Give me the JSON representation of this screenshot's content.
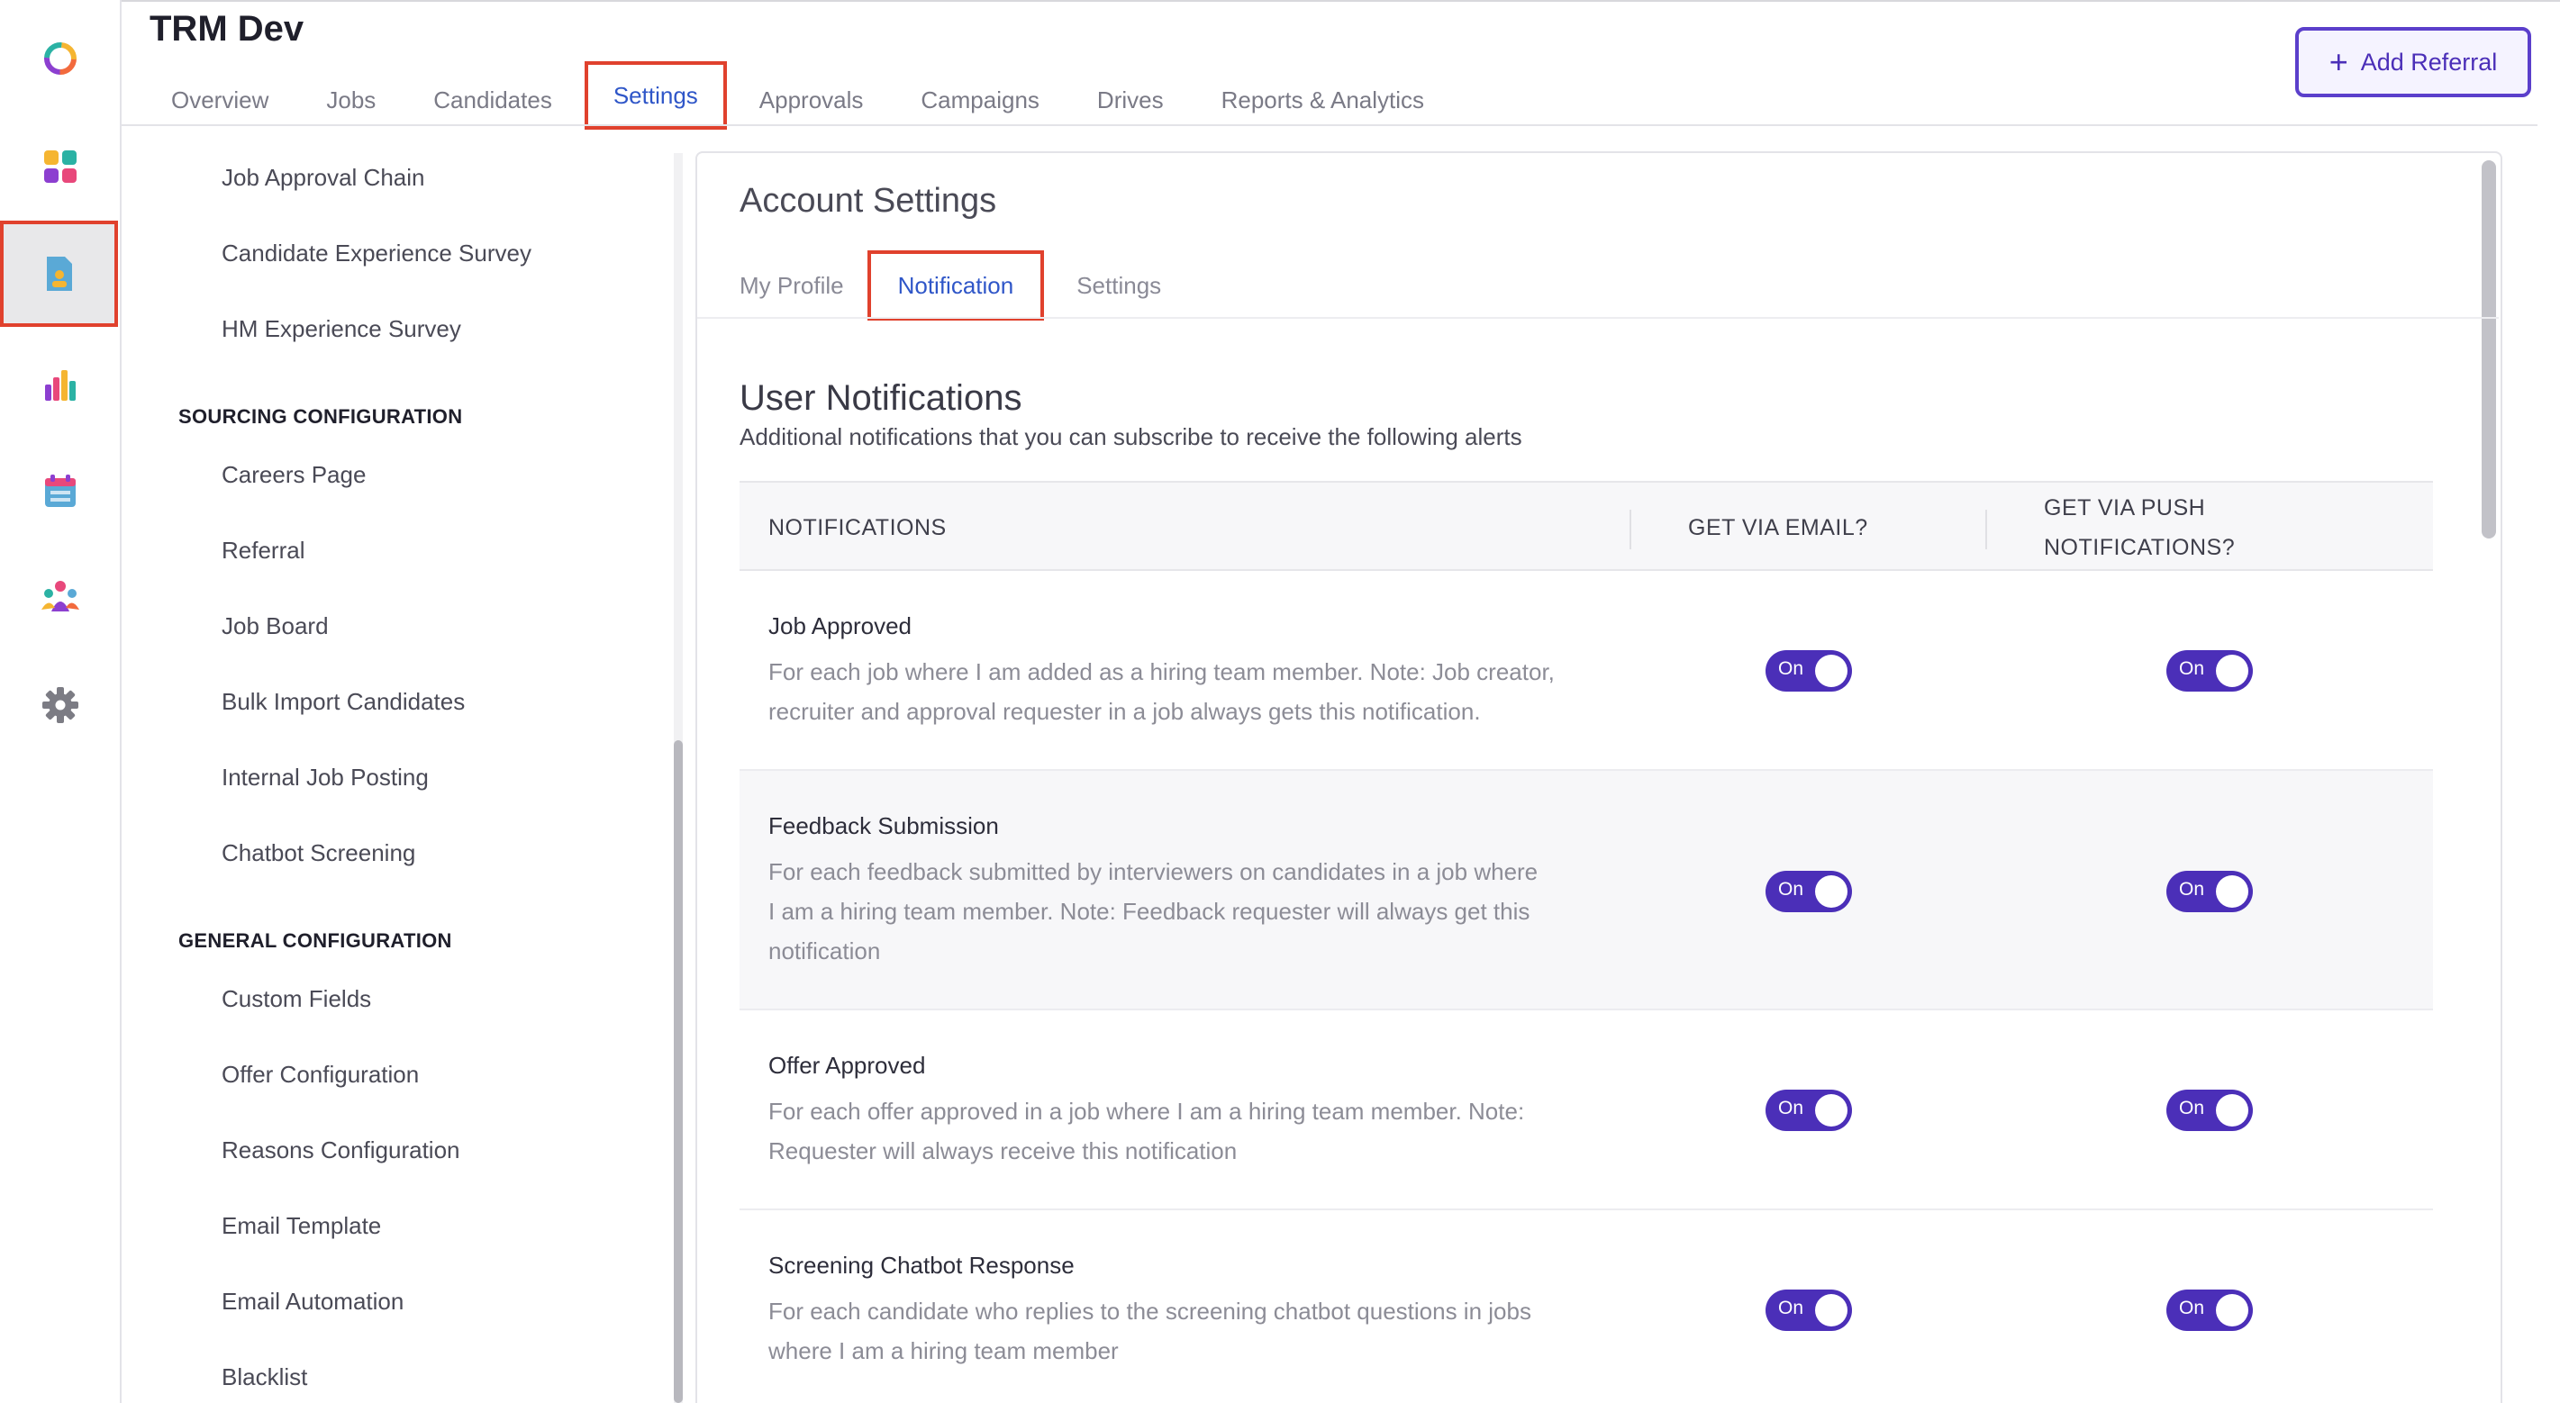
{
  "app": {
    "title": "TRM Dev"
  },
  "rail": {
    "items": [
      "logo-icon",
      "dashboard-icon",
      "document-icon",
      "analytics-icon",
      "calendar-icon",
      "team-icon",
      "gear-icon"
    ],
    "active": "document-icon"
  },
  "main_tabs": [
    {
      "label": "Overview"
    },
    {
      "label": "Jobs"
    },
    {
      "label": "Candidates"
    },
    {
      "label": "Settings",
      "active": true
    },
    {
      "label": "Approvals"
    },
    {
      "label": "Campaigns"
    },
    {
      "label": "Drives"
    },
    {
      "label": "Reports & Analytics"
    }
  ],
  "add_referral": {
    "icon": "plus-icon",
    "label": "Add Referral"
  },
  "settings_nav": {
    "items_top": [
      "Job Approval Chain",
      "Candidate Experience Survey",
      "HM Experience Survey"
    ],
    "sourcing_heading": "SOURCING CONFIGURATION",
    "sourcing_items": [
      "Careers Page",
      "Referral",
      "Job Board",
      "Bulk Import Candidates",
      "Internal Job Posting",
      "Chatbot Screening"
    ],
    "general_heading": "GENERAL CONFIGURATION",
    "general_items": [
      "Custom Fields",
      "Offer Configuration",
      "Reasons Configuration",
      "Email Template",
      "Email Automation",
      "Blacklist"
    ]
  },
  "account": {
    "title": "Account Settings",
    "tabs": [
      {
        "label": "My Profile"
      },
      {
        "label": "Notification",
        "active": true
      },
      {
        "label": "Settings"
      }
    ]
  },
  "user_notifications": {
    "title": "User Notifications",
    "description": "Additional notifications that you can subscribe to receive the following alerts",
    "columns": {
      "notifications": "NOTIFICATIONS",
      "email": "GET VIA EMAIL?",
      "push_line1": "GET VIA PUSH",
      "push_line2": "NOTIFICATIONS?"
    },
    "rows": [
      {
        "title": "Job Approved",
        "desc_lines": [
          "For each job where I am added as a hiring team member. Note: Job creator,",
          "recruiter and approval requester in a job always gets this notification."
        ],
        "email": "On",
        "push": "On"
      },
      {
        "title": "Feedback Submission",
        "desc_lines": [
          "For each feedback submitted by interviewers on candidates in a job where",
          "I am a hiring team member. Note: Feedback requester will always get this",
          "notification"
        ],
        "email": "On",
        "push": "On"
      },
      {
        "title": "Offer Approved",
        "desc_lines": [
          "For each offer approved in a job where I am a hiring team member. Note:",
          "Requester will always receive this notification"
        ],
        "email": "On",
        "push": "On"
      },
      {
        "title": "Screening Chatbot Response",
        "desc_lines": [
          "For each candidate who replies to the screening chatbot questions in jobs",
          "where I am a hiring team member"
        ],
        "email": "On",
        "push": "On"
      }
    ]
  },
  "colors": {
    "accent": "#4b2fb8",
    "tab_active": "#2f56c8",
    "highlight": "#e0412d"
  }
}
